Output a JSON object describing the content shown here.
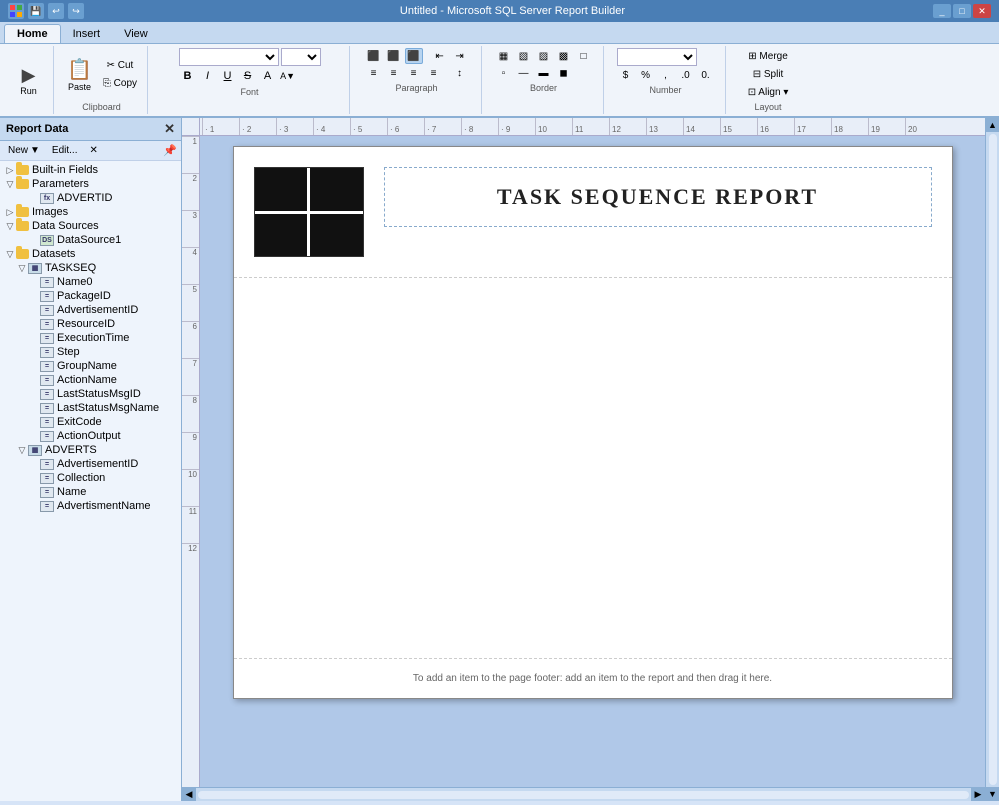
{
  "titleBar": {
    "title": "Untitled - Microsoft SQL Server Report Builder",
    "icons": [
      "logo",
      "save",
      "undo",
      "redo"
    ]
  },
  "tabs": [
    {
      "label": "Home",
      "active": true
    },
    {
      "label": "Insert",
      "active": false
    },
    {
      "label": "View",
      "active": false
    }
  ],
  "ribbon": {
    "groups": [
      {
        "name": "Run",
        "label": "Run",
        "type": "big-button"
      },
      {
        "name": "clipboard",
        "label": "Clipboard",
        "buttons": [
          "Paste",
          "Cut",
          "Copy"
        ]
      },
      {
        "name": "font",
        "label": "Font",
        "fontFace": "",
        "fontSize": ""
      },
      {
        "name": "paragraph",
        "label": "Paragraph"
      },
      {
        "name": "border",
        "label": "Border"
      },
      {
        "name": "number",
        "label": "Number"
      },
      {
        "name": "layout",
        "label": "Layout",
        "buttons": [
          "Merge",
          "Split",
          "Align"
        ]
      }
    ]
  },
  "reportDataPanel": {
    "title": "Report Data",
    "toolbar": {
      "newLabel": "New",
      "editLabel": "Edit..."
    },
    "tree": [
      {
        "id": "built-in-fields",
        "label": "Built-in Fields",
        "level": 0,
        "type": "folder",
        "expanded": false
      },
      {
        "id": "parameters",
        "label": "Parameters",
        "level": 0,
        "type": "folder",
        "expanded": true
      },
      {
        "id": "advertid-param",
        "label": "ADVERTID",
        "level": 1,
        "type": "parameter"
      },
      {
        "id": "images",
        "label": "Images",
        "level": 0,
        "type": "folder",
        "expanded": false
      },
      {
        "id": "data-sources",
        "label": "Data Sources",
        "level": 0,
        "type": "folder",
        "expanded": true
      },
      {
        "id": "datasource1",
        "label": "DataSource1",
        "level": 1,
        "type": "datasource"
      },
      {
        "id": "datasets",
        "label": "Datasets",
        "level": 0,
        "type": "folder",
        "expanded": true
      },
      {
        "id": "taskseq",
        "label": "TASKSEQ",
        "level": 1,
        "type": "dataset",
        "expanded": true
      },
      {
        "id": "name0",
        "label": "Name0",
        "level": 2,
        "type": "field"
      },
      {
        "id": "packageid",
        "label": "PackageID",
        "level": 2,
        "type": "field"
      },
      {
        "id": "advertisementid",
        "label": "AdvertisementID",
        "level": 2,
        "type": "field"
      },
      {
        "id": "resourceid",
        "label": "ResourceID",
        "level": 2,
        "type": "field"
      },
      {
        "id": "executiontime",
        "label": "ExecutionTime",
        "level": 2,
        "type": "field"
      },
      {
        "id": "step",
        "label": "Step",
        "level": 2,
        "type": "field"
      },
      {
        "id": "groupname",
        "label": "GroupName",
        "level": 2,
        "type": "field"
      },
      {
        "id": "actionname",
        "label": "ActionName",
        "level": 2,
        "type": "field"
      },
      {
        "id": "laststatusmsgid",
        "label": "LastStatusMsgID",
        "level": 2,
        "type": "field"
      },
      {
        "id": "laststatusmsgname",
        "label": "LastStatusMsgName",
        "level": 2,
        "type": "field"
      },
      {
        "id": "exitcode",
        "label": "ExitCode",
        "level": 2,
        "type": "field"
      },
      {
        "id": "actionoutput",
        "label": "ActionOutput",
        "level": 2,
        "type": "field"
      },
      {
        "id": "adverts",
        "label": "ADVERTS",
        "level": 1,
        "type": "dataset",
        "expanded": true
      },
      {
        "id": "adv-advertisementid",
        "label": "AdvertisementID",
        "level": 2,
        "type": "field"
      },
      {
        "id": "adv-collection",
        "label": "Collection",
        "level": 2,
        "type": "field"
      },
      {
        "id": "adv-name",
        "label": "Name",
        "level": 2,
        "type": "field"
      },
      {
        "id": "adv-advertismentname",
        "label": "AdvertismentName",
        "level": 2,
        "type": "field"
      }
    ]
  },
  "reportPage": {
    "title": "TASK SEQUENCE REPORT",
    "footerText": "To add an item to the page footer: add an item to the report and then drag it here."
  },
  "ruler": {
    "marks": [
      "1",
      "2",
      "3",
      "4",
      "5",
      "6",
      "7",
      "8",
      "9",
      "10",
      "11",
      "12",
      "13",
      "14",
      "15",
      "16",
      "17",
      "18",
      "19",
      "20"
    ]
  }
}
